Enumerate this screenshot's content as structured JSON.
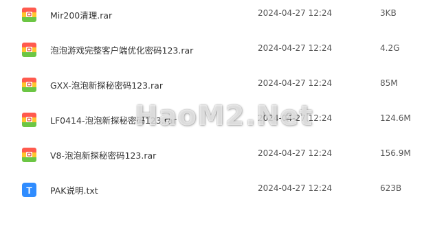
{
  "files": [
    {
      "name": "Mir200清理.rar",
      "date": "2024-04-27 12:24",
      "size": "3KB",
      "type": "rar",
      "icon": "archive-icon"
    },
    {
      "name": "泡泡游戏完整客户端优化密码123.rar",
      "date": "2024-04-27 12:24",
      "size": "4.2G",
      "type": "rar",
      "icon": "archive-icon"
    },
    {
      "name": "GXX-泡泡新探秘密码123.rar",
      "date": "2024-04-27 12:24",
      "size": "85M",
      "type": "rar",
      "icon": "archive-icon"
    },
    {
      "name": "LF0414-泡泡新探秘密码123.rar",
      "date": "2024-04-27 12:24",
      "size": "124.6M",
      "type": "rar",
      "icon": "archive-icon"
    },
    {
      "name": "V8-泡泡新探秘密码123.rar",
      "date": "2024-04-27 12:24",
      "size": "156.9M",
      "type": "rar",
      "icon": "archive-icon"
    },
    {
      "name": "PAK说明.txt",
      "date": "2024-04-27 12:24",
      "size": "623B",
      "type": "txt",
      "icon": "text-file-icon",
      "icon_letter": "T"
    }
  ],
  "watermark": "HaoM2.Net",
  "colors": {
    "archive_red": "#ff5a4e",
    "archive_yellow": "#ffc52e",
    "archive_green": "#6cc644",
    "txt_blue": "#2f8cff"
  }
}
